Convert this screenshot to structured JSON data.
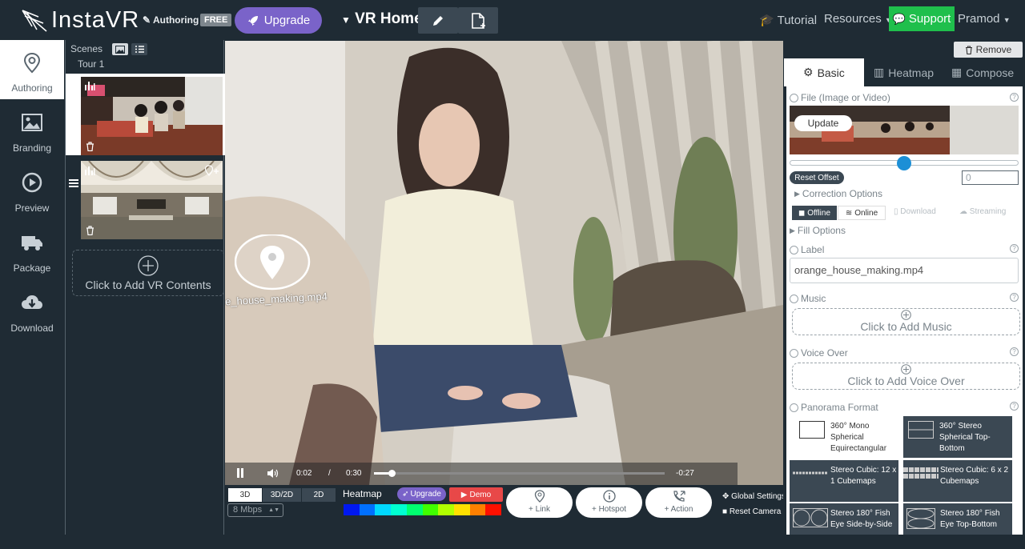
{
  "header": {
    "logo_text": "InstaVR",
    "authoring": "Authoring",
    "free_badge": "FREE",
    "upgrade": "Upgrade",
    "project_title": "VR Home",
    "tutorial": "Tutorial",
    "resources": "Resources",
    "support": "Support",
    "user": "Pramod"
  },
  "nav": [
    {
      "label": "Authoring",
      "icon": "map-pin-icon",
      "active": true
    },
    {
      "label": "Branding",
      "icon": "image-icon"
    },
    {
      "label": "Preview",
      "icon": "play-circle-icon"
    },
    {
      "label": "Package",
      "icon": "truck-icon"
    },
    {
      "label": "Download",
      "icon": "cloud-download-icon"
    }
  ],
  "scenes": {
    "title": "Scenes",
    "tour": "Tour 1",
    "add_vr": "Click to Add VR Contents"
  },
  "viewer": {
    "hotspot_label": "e_house_making.mp4",
    "time_current": "0:02",
    "time_sep": "/",
    "time_total": "0:30",
    "time_remaining": "-0:27",
    "progress": 0.06,
    "modes": [
      "3D",
      "3D/2D",
      "2D"
    ],
    "bitrate": "8 Mbps",
    "heatmap": "Heatmap",
    "heatmap_upgrade": "Upgrade",
    "demo": "Demo",
    "add_link": "+ Link",
    "add_hotspot": "+ Hotspot",
    "add_action": "+ Action",
    "global_settings": "Global Settings",
    "reset_camera": "Reset Camera",
    "heatmap_colors": [
      "#0018f0",
      "#0070ff",
      "#00d8ff",
      "#00ffd0",
      "#00ff70",
      "#40ff00",
      "#b0ff00",
      "#ffe000",
      "#ff8000",
      "#ff1000"
    ]
  },
  "right": {
    "remove": "Remove",
    "tabs": [
      "Basic",
      "Heatmap",
      "Compose"
    ],
    "file_label": "File (Image or Video)",
    "update": "Update",
    "reset_offset": "Reset Offset",
    "offset_value": "0",
    "offset_slider": 0.5,
    "correction": "Correction Options",
    "offline": "Offline",
    "online": "Online",
    "download": "Download",
    "streaming": "Streaming",
    "fill": "Fill Options",
    "label_title": "Label",
    "label_value": "orange_house_making.mp4",
    "music": "Music",
    "add_music": "Click to Add Music",
    "voice_over": "Voice Over",
    "add_voice": "Click to Add Voice Over",
    "panorama": "Panorama Format",
    "formats": [
      "360° Mono Spherical Equirectangular",
      "360° Stereo Spherical Top-Bottom",
      "Stereo Cubic: 12 x 1 Cubemaps",
      "Stereo Cubic: 6 x 2 Cubemaps",
      "Stereo 180° Fish Eye Side-by-Side",
      "Stereo 180° Fish Eye Top-Bottom"
    ]
  }
}
